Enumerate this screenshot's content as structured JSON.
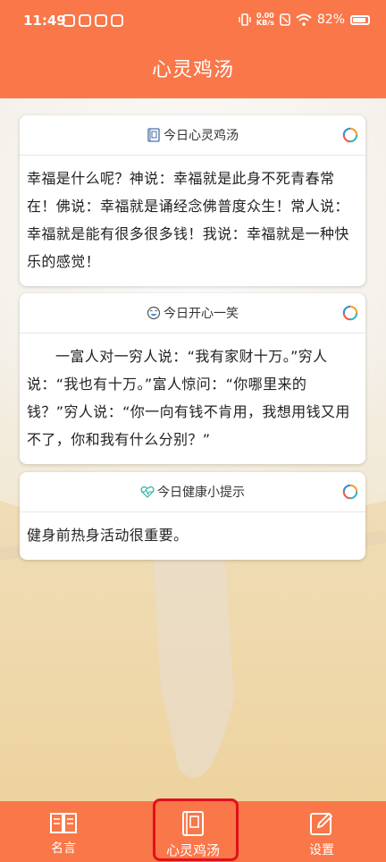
{
  "status_bar": {
    "time": "11:49",
    "net_speed_value": "0.00",
    "net_speed_unit": "KB/s",
    "battery": "82%"
  },
  "app_bar": {
    "title": "心灵鸡汤"
  },
  "cards": [
    {
      "title": "今日心灵鸡汤",
      "icon": "notebook-icon",
      "body": "幸福是什么呢？神说：幸福就是此身不死青春常在！佛说：幸福就是诵经念佛普度众生！常人说：幸福就是能有很多很多钱！我说：幸福就是一种快乐的感觉！"
    },
    {
      "title": "今日开心一笑",
      "icon": "laugh-face-icon",
      "body": "一富人对一穷人说：“我有家财十万。”穷人说：“我也有十万。”富人惊问：“你哪里来的钱？”穷人说：“你一向有钱不肯用，我想用钱又用不了，你和我有什么分别？”"
    },
    {
      "title": "今日健康小提示",
      "icon": "heartbeat-icon",
      "body": "健身前热身活动很重要。"
    }
  ],
  "tabs": [
    {
      "label": "名言",
      "icon": "book-icon"
    },
    {
      "label": "心灵鸡汤",
      "icon": "notebook-icon"
    },
    {
      "label": "设置",
      "icon": "edit-icon"
    }
  ],
  "colors": {
    "primary": "#f97749",
    "highlight": "#e3101b"
  }
}
